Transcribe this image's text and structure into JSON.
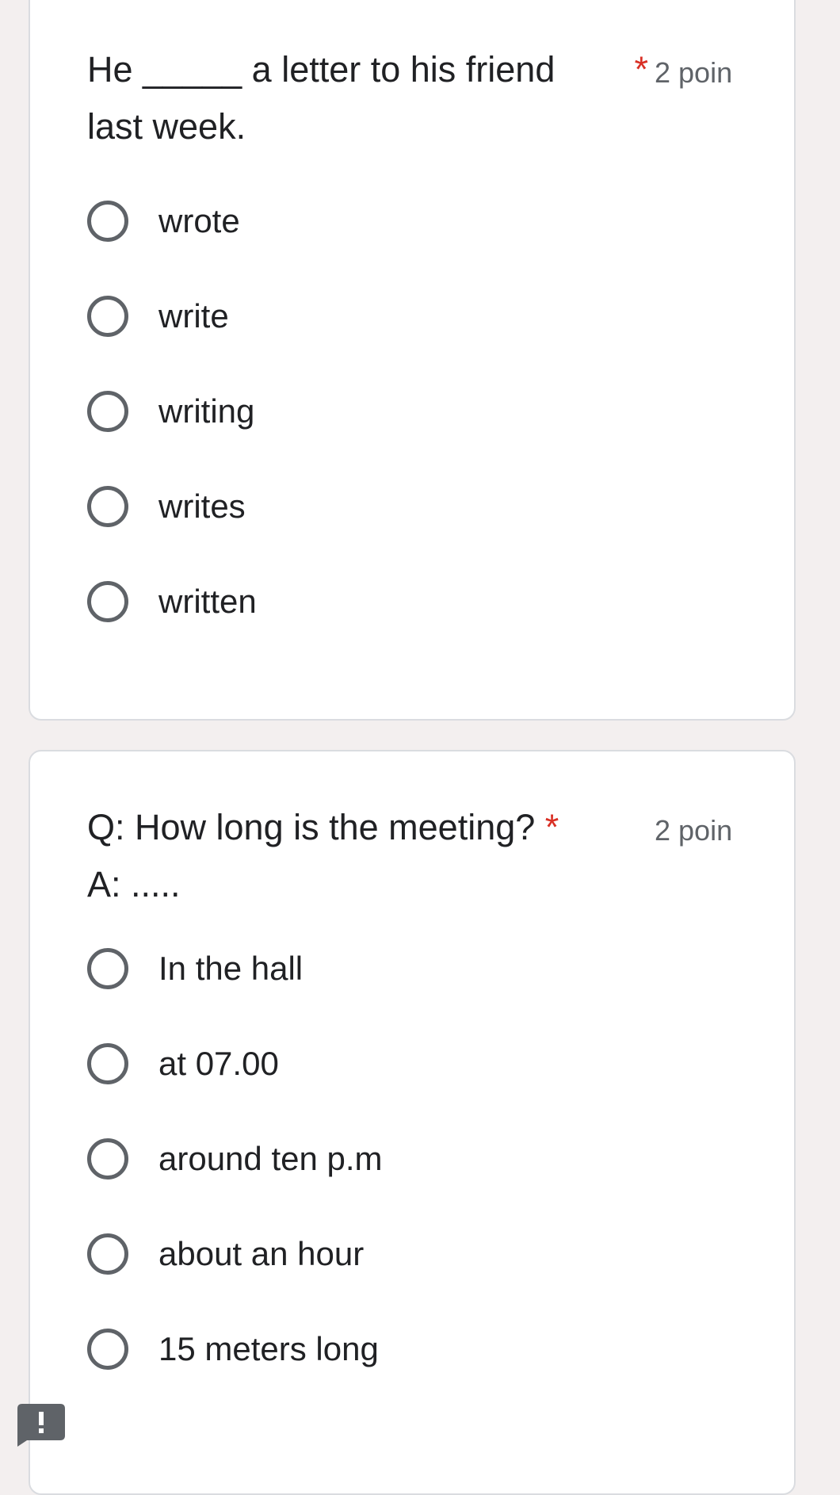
{
  "questions": [
    {
      "title": "He _____ a letter to his friend\nlast week.",
      "required_mark": "*",
      "points": "2 poin",
      "options": [
        "wrote",
        "write",
        "writing",
        "writes",
        "written"
      ]
    },
    {
      "title_text": "Q:  How long is the meeting? ",
      "title_line2": "A:  .....",
      "required_mark": "*",
      "points": "2 poin",
      "options": [
        "In the hall",
        "at 07.00",
        "around ten p.m",
        "about an hour",
        "15 meters long"
      ]
    }
  ],
  "report_icon": "exclamation-report-icon",
  "colors": {
    "background": "#f3efef",
    "card": "#ffffff",
    "required": "#d93025",
    "radio_border": "#5f6368",
    "text": "#202124",
    "points": "#5f6368"
  }
}
